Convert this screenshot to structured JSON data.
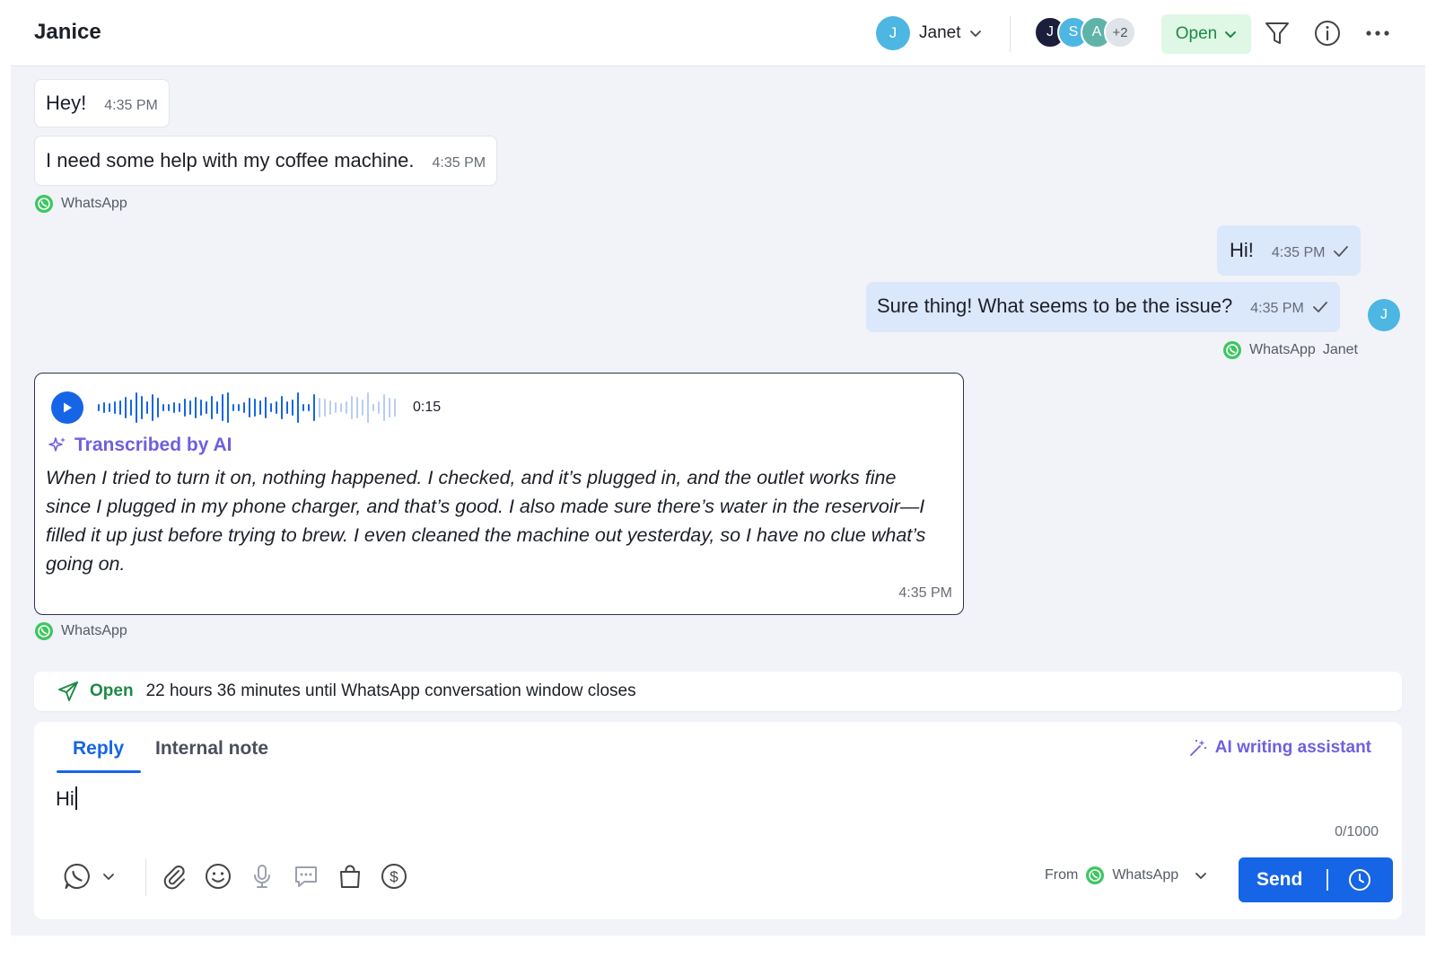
{
  "header": {
    "title": "Janice",
    "assignee": {
      "initial": "J",
      "name": "Janet",
      "color": "#4db6e3"
    },
    "participants": [
      {
        "initial": "J",
        "color": "#1b1f3b"
      },
      {
        "initial": "S",
        "color": "#4db6e3"
      },
      {
        "initial": "A",
        "color": "#5fb3a9"
      }
    ],
    "participants_more": "+2",
    "status": "Open",
    "icons": [
      "filter-icon",
      "info-icon",
      "more-icon"
    ]
  },
  "messages": {
    "m1": {
      "text": "Hey!",
      "time": "4:35 PM"
    },
    "m2": {
      "text": "I need some help with my coffee machine.",
      "time": "4:35 PM"
    },
    "channel_in_1": "WhatsApp",
    "m3": {
      "text": "Hi!",
      "time": "4:35 PM"
    },
    "m4": {
      "text": "Sure thing! What seems to be the issue?",
      "time": "4:35 PM"
    },
    "channel_out": "WhatsApp",
    "agent_name": "Janet",
    "agent_initial": "J"
  },
  "voice": {
    "duration": "0:15",
    "transcribed_label": "Transcribed by AI",
    "transcript": "When I tried to turn it on, nothing happened. I checked, and it’s plugged in, and the outlet works fine since I plugged in my phone charger, and that’s good. I also made sure there’s water in the reservoir—I filled it up just before trying to brew. I even cleaned the machine out yesterday, so I have no clue what’s going on.",
    "time": "4:35 PM",
    "channel": "WhatsApp",
    "played_fraction": 0.73
  },
  "banner": {
    "status": "Open",
    "text": "22 hours 36 minutes until WhatsApp conversation window closes"
  },
  "composer": {
    "tab_reply": "Reply",
    "tab_note": "Internal note",
    "ai_assistant": "AI writing assistant",
    "draft": "Hi",
    "counter": "0/1000",
    "from_label": "From",
    "from_channel": "WhatsApp",
    "send_label": "Send",
    "tools": [
      "whatsapp-icon",
      "attachment-icon",
      "emoji-icon",
      "microphone-icon",
      "chat-template-icon",
      "shopping-bag-icon",
      "payment-icon"
    ]
  },
  "colors": {
    "accent": "#1565e6",
    "ai": "#6e5fe0",
    "open_green": "#1d8a45",
    "whatsapp": "#3cc761",
    "outgoing_bubble": "#dbe7fb"
  }
}
